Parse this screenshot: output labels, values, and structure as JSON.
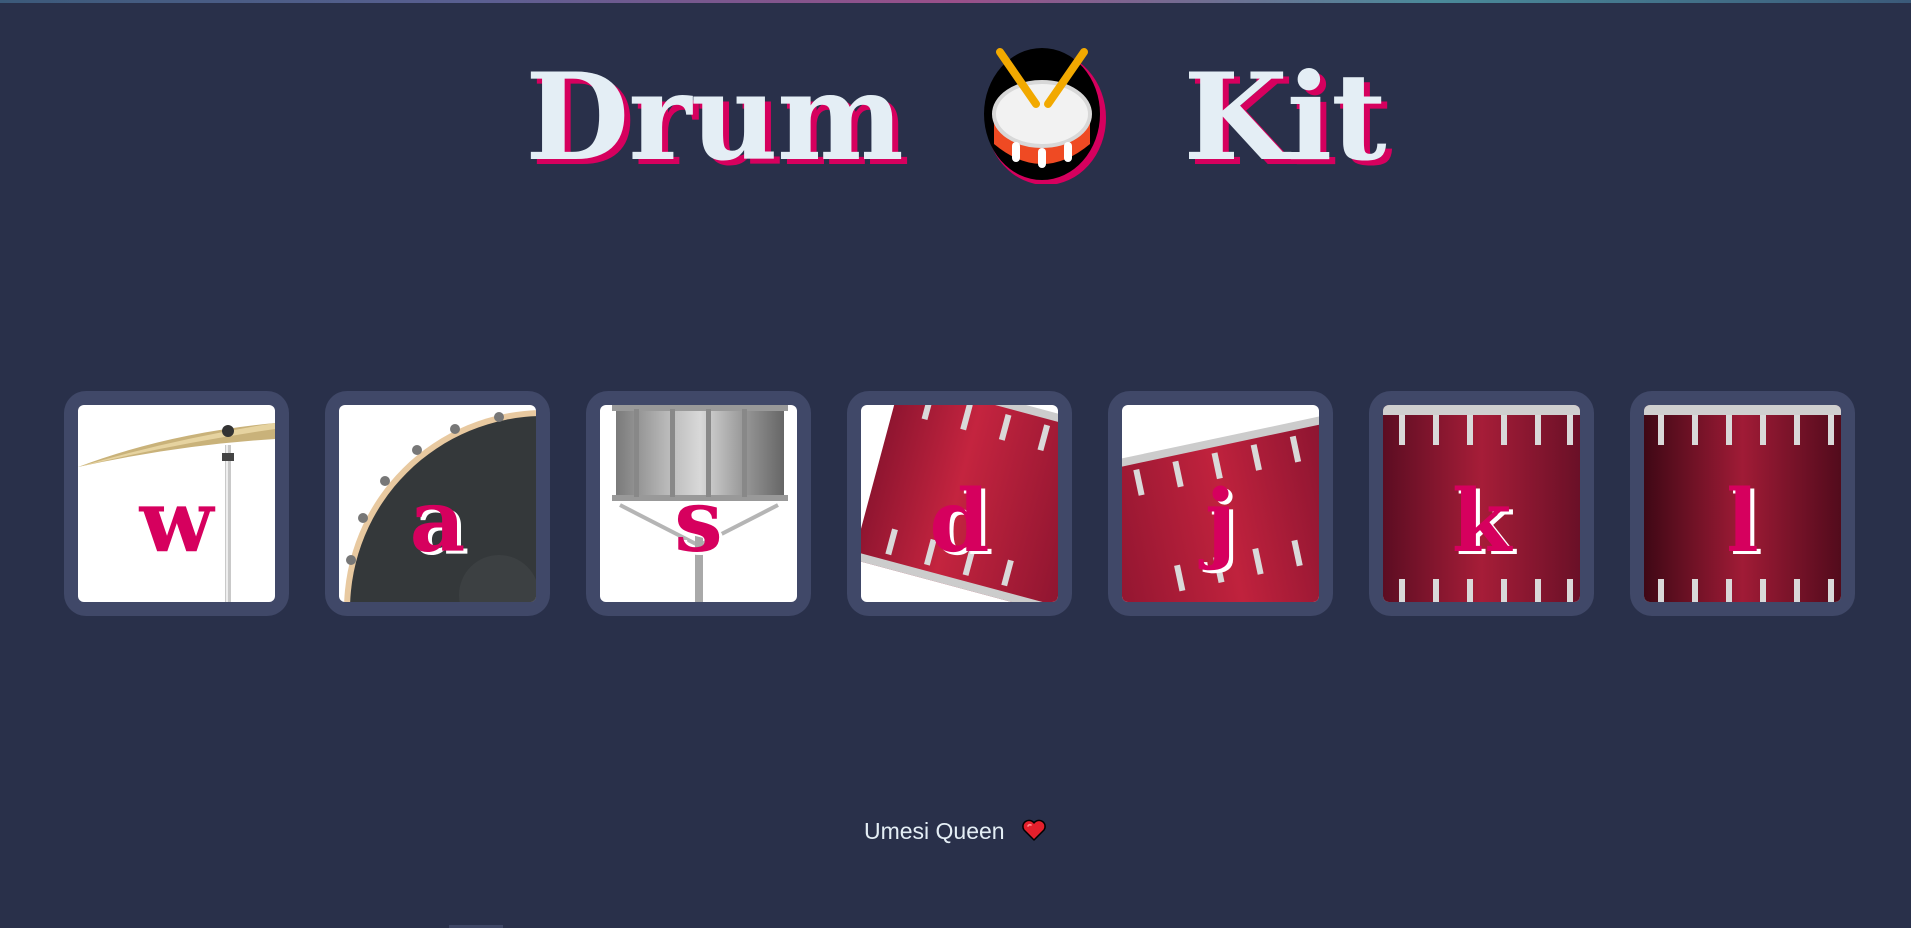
{
  "page": {
    "title_left": "Drum",
    "title_icon": "drum-emoji-icon",
    "title_right": "Kit"
  },
  "drums": [
    {
      "key": "w",
      "instrument": "crash",
      "icon": "crash-cymbal"
    },
    {
      "key": "a",
      "instrument": "kick",
      "icon": "bass-drum"
    },
    {
      "key": "s",
      "instrument": "snare",
      "icon": "snare-drum"
    },
    {
      "key": "d",
      "instrument": "tom",
      "icon": "tom-drum"
    },
    {
      "key": "j",
      "instrument": "tom",
      "icon": "tom-drum"
    },
    {
      "key": "k",
      "instrument": "tom",
      "icon": "floor-tom"
    },
    {
      "key": "l",
      "instrument": "tom",
      "icon": "floor-tom"
    }
  ],
  "footer": {
    "author": "Umesi Queen",
    "icon": "heart-icon"
  },
  "colors": {
    "background": "#29304a",
    "accent": "#d6005e",
    "title_text": "#e4eef5",
    "key_frame": "#404868"
  }
}
